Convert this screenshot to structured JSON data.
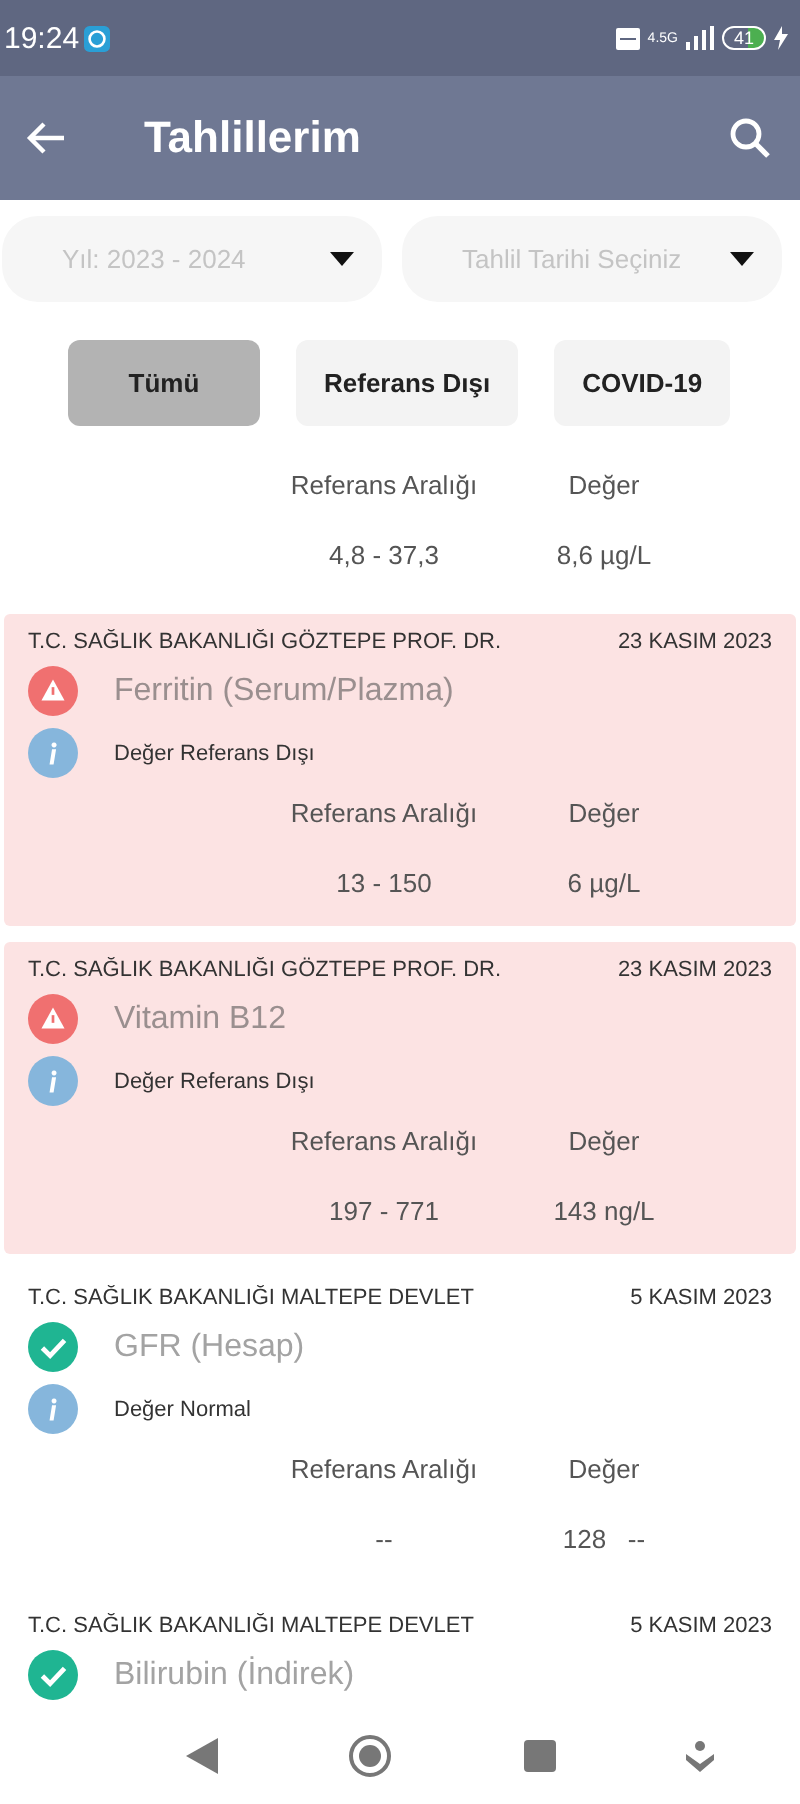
{
  "status_bar": {
    "time": "19:24",
    "network": "4.5G",
    "battery": "41"
  },
  "app_bar": {
    "title": "Tahlillerim"
  },
  "filters": [
    {
      "placeholder": "Yıl: 2023 - 2024"
    },
    {
      "placeholder": "Tahlil Tarihi Seçiniz"
    }
  ],
  "chips": [
    {
      "label": "Tümü",
      "selected": true
    },
    {
      "label": "Referans Dışı",
      "selected": false
    },
    {
      "label": "COVID-19",
      "selected": false
    }
  ],
  "results": [
    {
      "flagged": false,
      "range_label": "Referans Aralığı",
      "value_label": "Değer",
      "range": "4,8 - 37,3",
      "value": "8,6 µg/L"
    },
    {
      "flagged": true,
      "hospital": "T.C. SAĞLIK BAKANLIĞI GÖZTEPE PROF. DR.",
      "date": "23 KASIM 2023",
      "kind": "alert",
      "test": "Ferritin (Serum/Plazma)",
      "note": "Değer Referans Dışı",
      "range_label": "Referans Aralığı",
      "value_label": "Değer",
      "range": "13 - 150",
      "value": "6 µg/L"
    },
    {
      "flagged": true,
      "hospital": "T.C. SAĞLIK BAKANLIĞI GÖZTEPE PROF. DR.",
      "date": "23 KASIM 2023",
      "kind": "alert",
      "test": "Vitamin B12",
      "note": "Değer Referans Dışı",
      "range_label": "Referans Aralığı",
      "value_label": "Değer",
      "range": "197 - 771",
      "value": "143 ng/L"
    },
    {
      "flagged": false,
      "hospital": "T.C. SAĞLIK BAKANLIĞI MALTEPE DEVLET",
      "date": "5 KASIM 2023",
      "kind": "ok",
      "test": "GFR (Hesap)",
      "note": "Değer Normal",
      "range_label": "Referans Aralığı",
      "value_label": "Değer",
      "range": "--",
      "value": "128   --"
    },
    {
      "flagged": false,
      "hospital": "T.C. SAĞLIK BAKANLIĞI MALTEPE DEVLET",
      "date": "5 KASIM 2023",
      "kind": "ok",
      "test": "Bilirubin (İndirek)"
    }
  ]
}
